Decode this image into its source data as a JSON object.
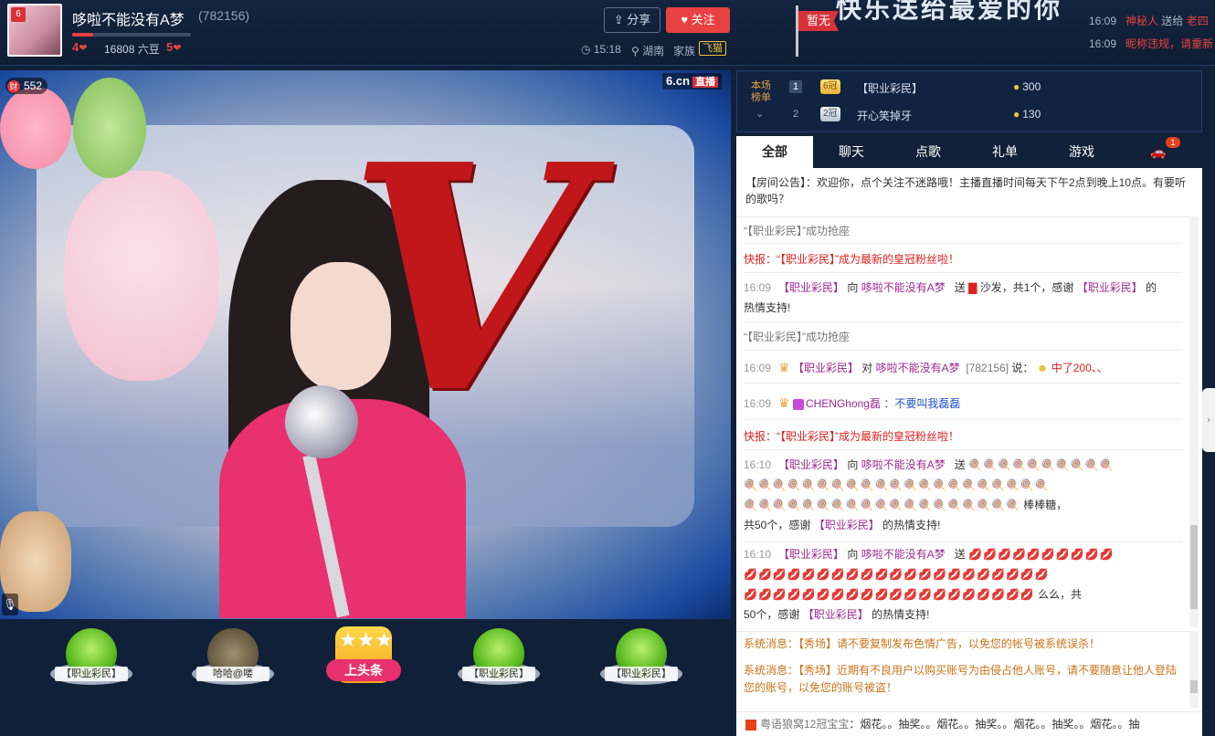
{
  "header": {
    "host_name": "哆啦不能没有A梦",
    "room_id": "(782156)",
    "level_left": "4",
    "beans": "16808 六豆",
    "level_right": "5",
    "share_label": "分享",
    "follow_label": "关注",
    "time": "15:18",
    "location": "湖南",
    "family_label": "家族",
    "family_tag": "飞猫",
    "flag_label": "暂无",
    "banner_text": "快乐送给最爱的你",
    "logo_small": "6",
    "progress_fraction": 0.18,
    "notices": [
      {
        "time": "16:09",
        "user": "神秘人",
        "action": "送给",
        "target": "老四"
      },
      {
        "time": "16:09",
        "text": "昵称违规，",
        "extra": "请重新"
      }
    ]
  },
  "video": {
    "site_logo": "6.cn",
    "live_badge": "直播",
    "wealth_icon": "财",
    "wealth_value": "552"
  },
  "seats": [
    {
      "label": "【职业彩民】",
      "avatar": "alien-icon"
    },
    {
      "label": "哈哈@喽",
      "avatar": "stone-face-icon"
    },
    {
      "label": "上头条",
      "avatar": "headline-icon"
    },
    {
      "label": "【职业彩民】",
      "avatar": "alien-icon"
    },
    {
      "label": "【职业彩民】",
      "avatar": "alien-icon"
    }
  ],
  "rank": {
    "title": "本场榜单",
    "rows": [
      {
        "num": "1",
        "crown": "6冠",
        "name": "【职业彩民】",
        "score": "300"
      },
      {
        "num": "2",
        "crown": "2冠",
        "name": "开心笑掉牙",
        "score": "130"
      }
    ]
  },
  "tabs": [
    "全部",
    "聊天",
    "点歌",
    "礼单",
    "游戏"
  ],
  "car_badge": "1",
  "announcement": "【房间公告】：欢迎你，点个关注不迷路哦！主播直播时间每天下午2点到晚上10点。有要听的歌吗？",
  "messages": {
    "m1": "“【职业彩民】”成功抢座",
    "m2_prefix": "快报：",
    "m2_text": "“【职业彩民】”成为最新的皇冠粉丝啦！",
    "m3_time": "16:09",
    "m3_user": "【职业彩民】",
    "m3_to": "向",
    "m3_host": "哆啦不能没有A梦",
    "m3_send": "送",
    "m3_gift": "沙发，共1个，感谢",
    "m3_user2": "【职业彩民】",
    "m3_end": "的",
    "m3_line2": "热情支持!",
    "m4": "“【职业彩民】”成功抢座",
    "m5_time": "16:09",
    "m5_user": "【职业彩民】",
    "m5_to": "对",
    "m5_host": "哆啦不能没有A梦",
    "m5_id": "[782156]",
    "m5_say": "说：",
    "m5_text": "中了200、、",
    "m6_time": "16:09",
    "m6_user": "CHENGhong磊",
    "m6_text": "：不要叫我磊磊",
    "m7_prefix": "快报：",
    "m7_text": "“【职业彩民】”成为最新的皇冠粉丝啦！",
    "m8_time": "16:10",
    "m8_user": "【职业彩民】",
    "m8_to": "向",
    "m8_host": "哆啦不能没有A梦",
    "m8_send": "送",
    "m8_gift_name": "棒棒糖，",
    "m8_line": "共50个，感谢",
    "m8_user2": "【职业彩民】",
    "m8_end": "的热情支持!",
    "m9_time": "16:10",
    "m9_user": "【职业彩民】",
    "m9_to": "向",
    "m9_host": "哆啦不能没有A梦",
    "m9_send": "送",
    "m9_gift_name": "么么，共",
    "m9_line": "50个，感谢",
    "m9_user2": "【职业彩民】",
    "m9_end": "的热情支持!"
  },
  "system": [
    {
      "prefix": "系统消息：",
      "tag": "【秀场】",
      "text": "请不要复制发布色情广告，以免您的帐号被系统误杀！"
    },
    {
      "prefix": "系统消息：",
      "tag": "【秀场】",
      "text": "近期有不良用户以购买账号为由侵占他人账号，请不要随意让他人登陆您的账号，以免您的账号被盗！"
    }
  ],
  "marquee": {
    "name": "粤语狼窝12冠宝宝",
    "text": "：烟花。。抽奖。。烟花。。抽奖。。烟花。。抽奖。。烟花。。抽"
  },
  "colors": {
    "accent": "#e84141",
    "background": "#0f2038",
    "username": "#9a2a92"
  }
}
